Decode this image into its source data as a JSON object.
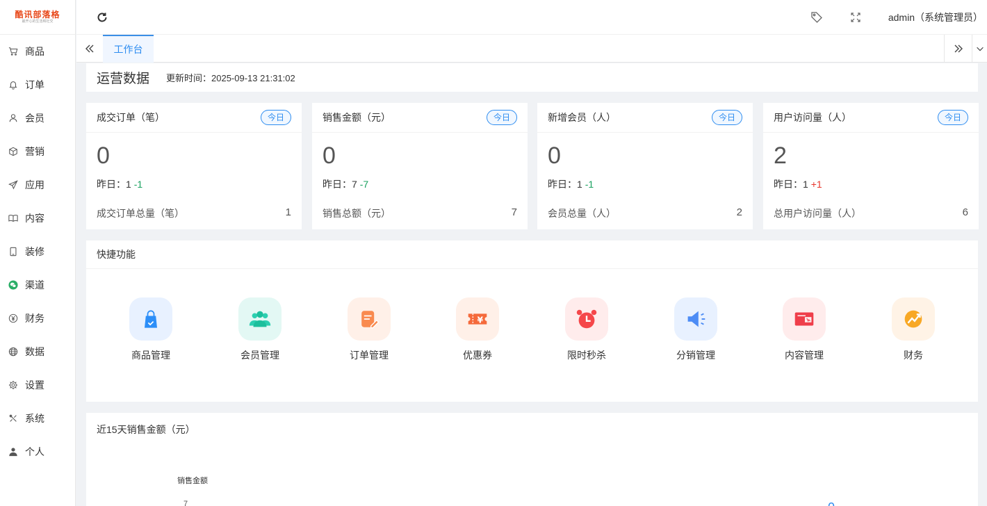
{
  "logo": {
    "title": "酷讯部落格",
    "subtitle": "最开心的生活和社交"
  },
  "sidebar": {
    "items": [
      {
        "label": "商品",
        "icon": "cart-icon"
      },
      {
        "label": "订单",
        "icon": "bell-icon"
      },
      {
        "label": "会员",
        "icon": "user-icon"
      },
      {
        "label": "营销",
        "icon": "cube-icon"
      },
      {
        "label": "应用",
        "icon": "paper-plane-icon"
      },
      {
        "label": "内容",
        "icon": "book-icon"
      },
      {
        "label": "装修",
        "icon": "tablet-icon"
      },
      {
        "label": "渠道",
        "icon": "wechat-icon"
      },
      {
        "label": "财务",
        "icon": "yen-icon"
      },
      {
        "label": "数据",
        "icon": "globe-icon"
      },
      {
        "label": "设置",
        "icon": "gear-icon"
      },
      {
        "label": "系统",
        "icon": "tools-icon"
      },
      {
        "label": "个人",
        "icon": "person-icon"
      }
    ]
  },
  "header": {
    "user": "admin（系统管理员）",
    "icons": [
      "refresh-icon",
      "tag-icon",
      "fullscreen-icon"
    ]
  },
  "tabs": {
    "active": "工作台"
  },
  "ops": {
    "title": "运营数据",
    "update_time": "更新时间：2025-09-13 21:31:02"
  },
  "stats": [
    {
      "title": "成交订单（笔）",
      "badge": "今日",
      "value": "0",
      "yesterday_label": "昨日：",
      "yesterday": "1",
      "diff": "-1",
      "diff_type": "neg",
      "total_label": "成交订单总量（笔）",
      "total": "1"
    },
    {
      "title": "销售金额（元）",
      "badge": "今日",
      "value": "0",
      "yesterday_label": "昨日：",
      "yesterday": "7",
      "diff": "-7",
      "diff_type": "neg",
      "total_label": "销售总额（元）",
      "total": "7"
    },
    {
      "title": "新增会员（人）",
      "badge": "今日",
      "value": "0",
      "yesterday_label": "昨日：",
      "yesterday": "1",
      "diff": "-1",
      "diff_type": "neg",
      "total_label": "会员总量（人）",
      "total": "2"
    },
    {
      "title": "用户访问量（人）",
      "badge": "今日",
      "value": "2",
      "yesterday_label": "昨日：",
      "yesterday": "1",
      "diff": "+1",
      "diff_type": "pos",
      "total_label": "总用户访问量（人）",
      "total": "6"
    }
  ],
  "quick": {
    "title": "快捷功能",
    "items": [
      {
        "label": "商品管理",
        "icon": "shopping-bag-icon"
      },
      {
        "label": "会员管理",
        "icon": "members-icon"
      },
      {
        "label": "订单管理",
        "icon": "order-edit-icon"
      },
      {
        "label": "优惠券",
        "icon": "coupon-icon"
      },
      {
        "label": "限时秒杀",
        "icon": "alarm-clock-icon"
      },
      {
        "label": "分销管理",
        "icon": "megaphone-icon"
      },
      {
        "label": "内容管理",
        "icon": "content-card-icon"
      },
      {
        "label": "财务",
        "icon": "finance-trend-icon"
      }
    ]
  },
  "chart": {
    "title": "近15天销售金额（元）",
    "series_name": "销售金额",
    "y_tick_visible": "7",
    "point_label_visible": "0"
  },
  "colors": {
    "accent": "#2d8cf0",
    "negative": "#19a15f",
    "positive": "#e8362c",
    "logo": "#e84a1c"
  }
}
